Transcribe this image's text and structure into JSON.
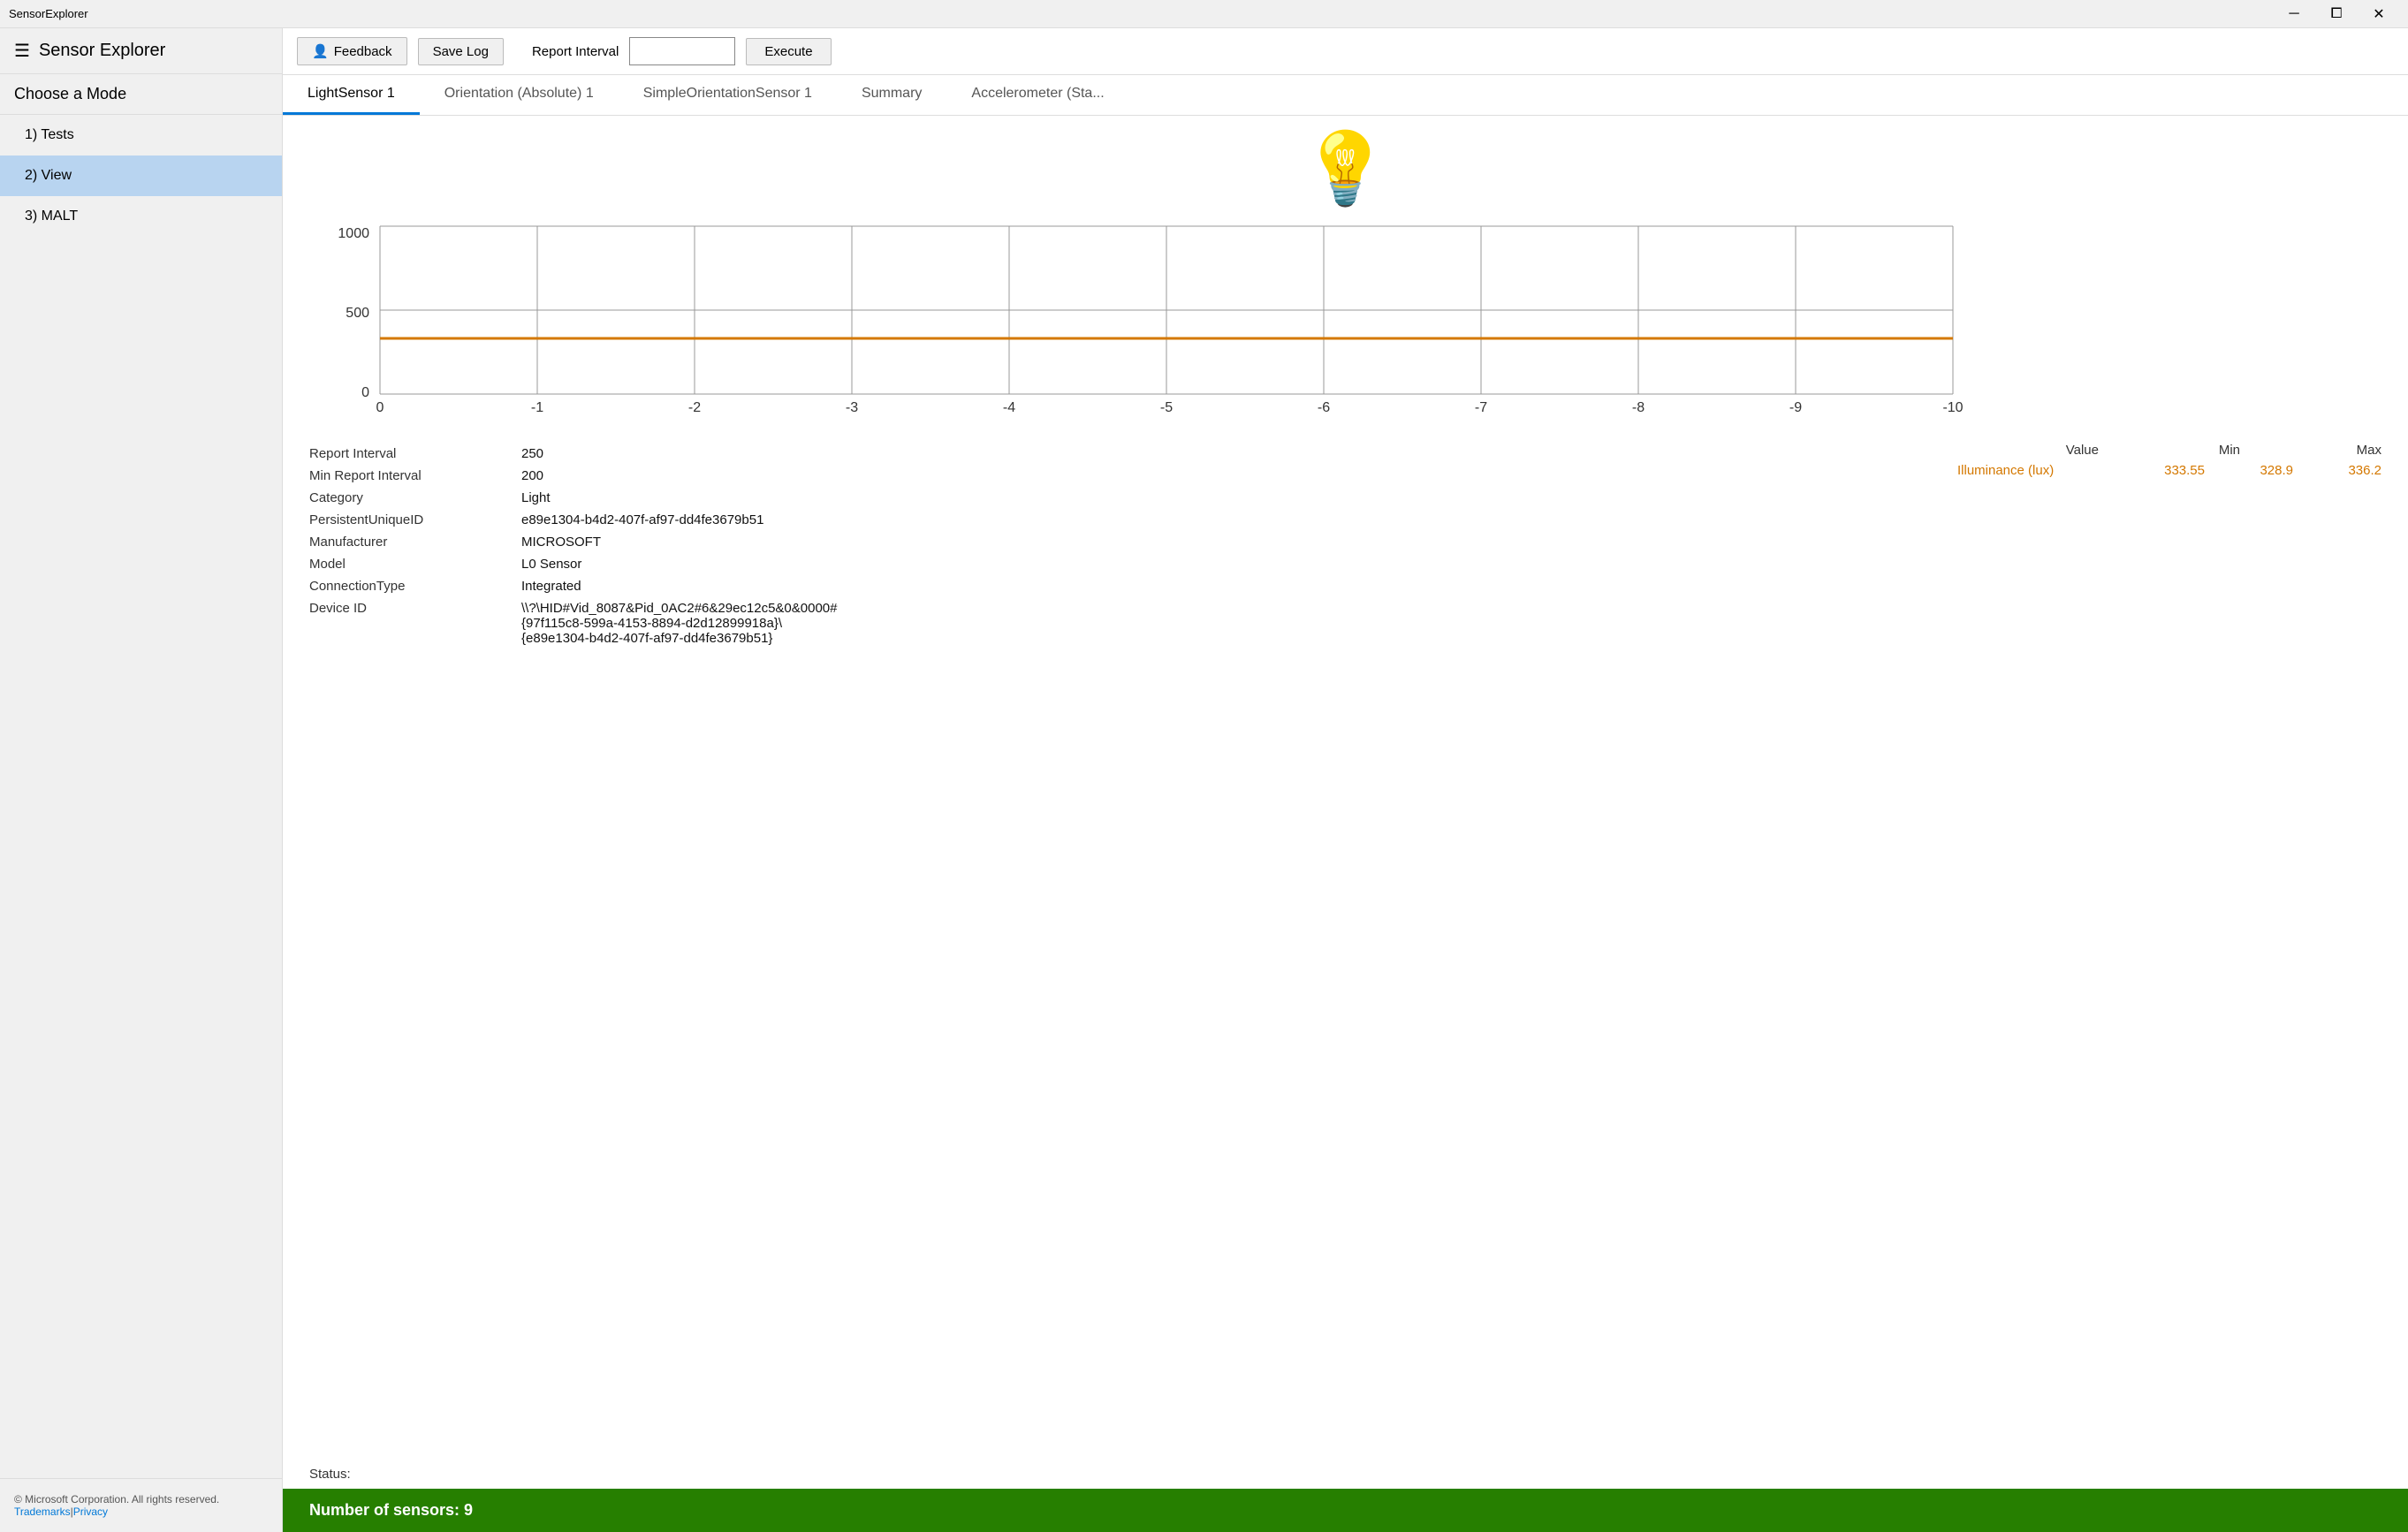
{
  "titlebar": {
    "title": "SensorExplorer",
    "minimize_label": "─",
    "maximize_label": "⧠",
    "close_label": "✕"
  },
  "sidebar": {
    "app_name": "Sensor Explorer",
    "choose_mode": "Choose a Mode",
    "nav_items": [
      {
        "id": "tests",
        "label": "1) Tests",
        "active": false
      },
      {
        "id": "view",
        "label": "2) View",
        "active": true
      },
      {
        "id": "malt",
        "label": "3) MALT",
        "active": false
      }
    ],
    "footer": {
      "copyright": "© Microsoft Corporation. All rights reserved.",
      "link_trademarks": "Trademarks",
      "link_privacy": "Privacy"
    }
  },
  "toolbar": {
    "feedback_label": "Feedback",
    "save_log_label": "Save Log",
    "report_interval_label": "Report Interval",
    "report_interval_value": "",
    "report_interval_placeholder": "",
    "execute_label": "Execute"
  },
  "tabs": [
    {
      "id": "lightsensor1",
      "label": "LightSensor 1",
      "active": true
    },
    {
      "id": "orientation_abs",
      "label": "Orientation (Absolute) 1",
      "active": false
    },
    {
      "id": "simple_orientation",
      "label": "SimpleOrientationSensor 1",
      "active": false
    },
    {
      "id": "summary",
      "label": "Summary",
      "active": false
    },
    {
      "id": "accelerometer",
      "label": "Accelerometer (Sta...",
      "active": false
    }
  ],
  "chart": {
    "y_labels": [
      "1000",
      "500",
      "0"
    ],
    "x_labels": [
      "0",
      "-1",
      "-2",
      "-3",
      "-4",
      "-5",
      "-6",
      "-7",
      "-8",
      "-9",
      "-10"
    ],
    "data_line_y": 320,
    "grid_color": "#999",
    "data_color": "#d47800"
  },
  "sensor_info": {
    "report_interval_label": "Report Interval",
    "report_interval_value": "250",
    "min_report_interval_label": "Min Report Interval",
    "min_report_interval_value": "200",
    "category_label": "Category",
    "category_value": "Light",
    "persistent_uid_label": "PersistentUniqueID",
    "persistent_uid_value": "e89e1304-b4d2-407f-af97-dd4fe3679b51",
    "manufacturer_label": "Manufacturer",
    "manufacturer_value": "MICROSOFT",
    "model_label": "Model",
    "model_value": "L0 Sensor",
    "connection_type_label": "ConnectionType",
    "connection_type_value": "Integrated",
    "device_id_label": "Device ID",
    "device_id_value_line1": "\\\\?\\HID#Vid_8087&Pid_0AC2#6&29ec12c5&0&0000#",
    "device_id_value_line2": "{97f115c8-599a-4153-8894-d2d12899918a}\\",
    "device_id_value_line3": "{e89e1304-b4d2-407f-af97-dd4fe3679b51}"
  },
  "readings": {
    "value_col": "Value",
    "min_col": "Min",
    "max_col": "Max",
    "illuminance_label": "Illuminance (lux)",
    "illuminance_value": "333.55",
    "illuminance_min": "328.9",
    "illuminance_max": "336.2"
  },
  "status": {
    "label": "Status:",
    "sensor_count": "Number of sensors: 9"
  }
}
